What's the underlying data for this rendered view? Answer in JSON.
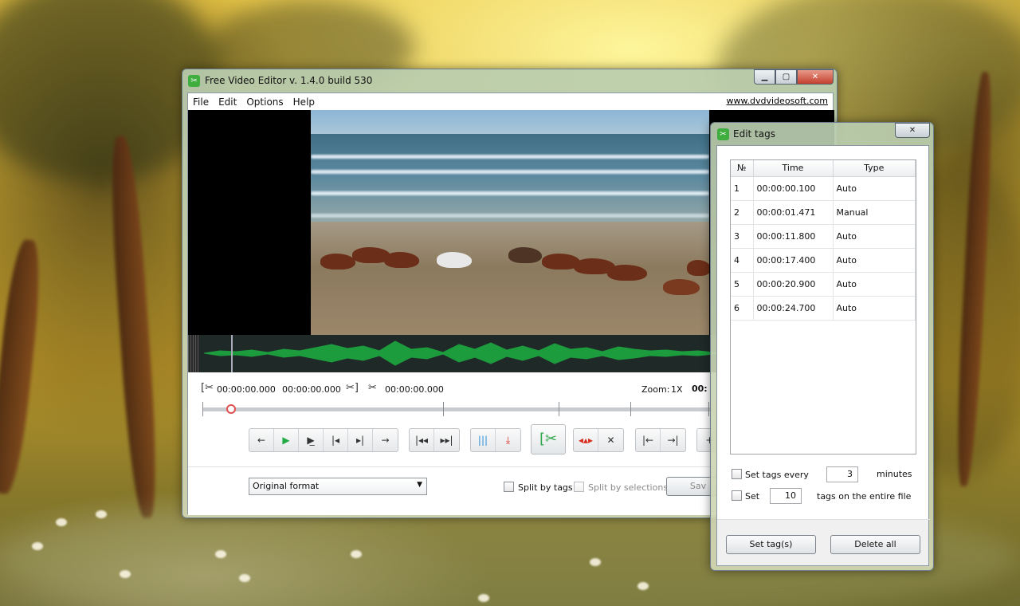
{
  "main_window": {
    "title": "Free Video Editor v. 1.4.0 build 530",
    "menu": [
      "File",
      "Edit",
      "Options",
      "Help"
    ],
    "website_link": "www.dvdvideosoft.com",
    "times": {
      "start": "00:00:00.000",
      "end": "00:00:00.000",
      "cut": "00:00:00.000"
    },
    "zoom_label": "Zoom:",
    "zoom_value": "1X",
    "time_partial": "00:",
    "format_select": "Original format",
    "split_by_tags": "Split by tags",
    "split_by_selections": "Split by selections",
    "save_button": "Sav"
  },
  "edit_tags": {
    "title": "Edit tags",
    "columns": [
      "№",
      "Time",
      "Type"
    ],
    "rows": [
      {
        "n": "1",
        "time": "00:00:00.100",
        "type": "Auto"
      },
      {
        "n": "2",
        "time": "00:00:01.471",
        "type": "Manual"
      },
      {
        "n": "3",
        "time": "00:00:11.800",
        "type": "Auto"
      },
      {
        "n": "4",
        "time": "00:00:17.400",
        "type": "Auto"
      },
      {
        "n": "5",
        "time": "00:00:20.900",
        "type": "Auto"
      },
      {
        "n": "6",
        "time": "00:00:24.700",
        "type": "Auto"
      }
    ],
    "set_tags_every_label": "Set tags every",
    "set_tags_every_value": "3",
    "minutes_label": "minutes",
    "set_label": "Set",
    "set_value": "10",
    "tags_on_file_label": "tags on the entire file",
    "set_tags_button": "Set tag(s)",
    "delete_all_button": "Delete all"
  },
  "colors": {
    "waveform": "#1c9c3c",
    "accent_green": "#2ea84a",
    "close_red": "#c4402f"
  }
}
